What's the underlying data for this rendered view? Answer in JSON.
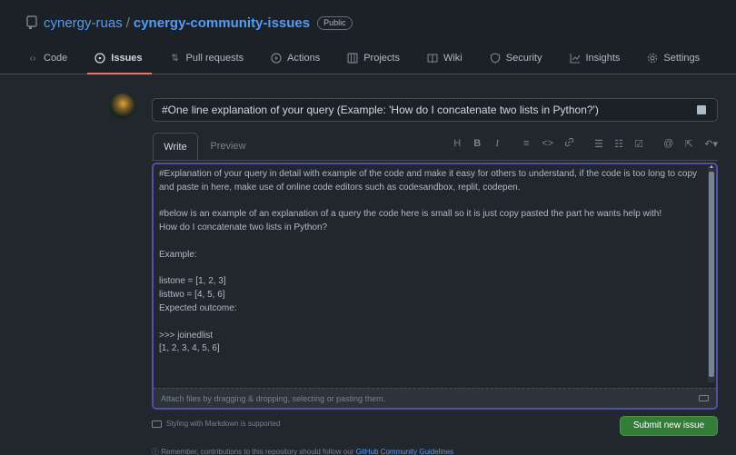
{
  "repo": {
    "owner": "cynergy-ruas",
    "separator": "/",
    "name": "cynergy-community-issues",
    "visibility": "Public"
  },
  "nav": {
    "tabs": [
      {
        "label": "Code",
        "icon": "code-icon"
      },
      {
        "label": "Issues",
        "icon": "issue-opened-icon",
        "active": true
      },
      {
        "label": "Pull requests",
        "icon": "pull-request-icon"
      },
      {
        "label": "Actions",
        "icon": "play-icon"
      },
      {
        "label": "Projects",
        "icon": "table-icon"
      },
      {
        "label": "Wiki",
        "icon": "book-icon"
      },
      {
        "label": "Security",
        "icon": "shield-icon"
      },
      {
        "label": "Insights",
        "icon": "graph-icon"
      },
      {
        "label": "Settings",
        "icon": "gear-icon"
      }
    ]
  },
  "issue": {
    "title_value": "#One line explanation of your query (Example: 'How do I concatenate two lists in Python?')",
    "editor_tabs": {
      "write": "Write",
      "preview": "Preview"
    },
    "toolbar": {
      "heading": "H",
      "bold": "B",
      "italic": "I",
      "quote": "≡",
      "code": "<>",
      "link": "🔗",
      "unordered_list": "☰",
      "ordered_list": "☷",
      "task_list": "☑",
      "mention": "@",
      "reference": "⇱",
      "undo": "↶▾"
    },
    "body_value": "#Explanation of your query in detail with example of the code and make it easy for others to understand, if the code is too long to copy and paste in here, make use of online code editors such as codesandbox, replit, codepen.\n\n#below is an example of an explanation of a query the code here is small so it is just copy pasted the part he wants help with!\nHow do I concatenate two lists in Python?\n\nExample:\n\nlistone = [1, 2, 3]\nlisttwo = [4, 5, 6]\nExpected outcome:\n\n>>> joinedlist\n[1, 2, 3, 4, 5, 6]",
    "attach_hint": "Attach files by dragging & dropping, selecting or pasting them.",
    "markdown_hint": "Styling with Markdown is supported",
    "submit_label": "Submit new issue",
    "reminder_text": "Remember, contributions to this repository should follow our ",
    "reminder_link": "GitHub Community Guidelines"
  },
  "colors": {
    "background": "#22272e",
    "header_background": "#1c2128",
    "link": "#539bf5",
    "active_tab_underline": "#ec775c",
    "submit_button": "#347d39",
    "focus_border": "#4f50a8"
  }
}
